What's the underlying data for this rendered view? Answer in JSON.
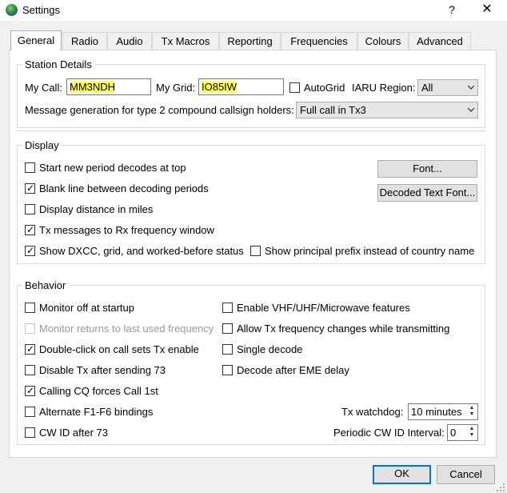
{
  "window": {
    "title": "Settings",
    "help": "?",
    "close": "✕"
  },
  "tabs": [
    {
      "label": "General"
    },
    {
      "label": "Radio"
    },
    {
      "label": "Audio"
    },
    {
      "label": "Tx Macros"
    },
    {
      "label": "Reporting"
    },
    {
      "label": "Frequencies"
    },
    {
      "label": "Colours"
    },
    {
      "label": "Advanced"
    }
  ],
  "station": {
    "title": "Station Details",
    "my_call_label": "My Call:",
    "my_call_value": "MM3NDH",
    "my_grid_label": "My Grid:",
    "my_grid_value": "IO85IW",
    "autogrid_label": "AutoGrid",
    "autogrid_checked": false,
    "iaru_label": "IARU Region:",
    "iaru_value": "All",
    "msggen_label": "Message generation for type 2 compound callsign holders:",
    "msggen_value": "Full call in Tx3"
  },
  "display": {
    "title": "Display",
    "items": [
      {
        "label": "Start new period decodes at top",
        "checked": false
      },
      {
        "label": "Blank line between decoding periods",
        "checked": true
      },
      {
        "label": "Display distance in miles",
        "checked": false
      },
      {
        "label": "Tx messages to Rx frequency window",
        "checked": true
      },
      {
        "label": "Show DXCC, grid, and worked-before status",
        "checked": true
      },
      {
        "label": "Show principal prefix instead of country name",
        "checked": false
      }
    ],
    "font_button": "Font...",
    "decoded_font_button": "Decoded Text Font..."
  },
  "behavior": {
    "title": "Behavior",
    "left": [
      {
        "label": "Monitor off at startup",
        "checked": false,
        "disabled": false
      },
      {
        "label": "Monitor returns to last used frequency",
        "checked": false,
        "disabled": true
      },
      {
        "label": "Double-click on call sets Tx enable",
        "checked": true,
        "disabled": false
      },
      {
        "label": "Disable Tx after sending 73",
        "checked": false,
        "disabled": false
      },
      {
        "label": "Calling CQ forces Call 1st",
        "checked": true,
        "disabled": false
      },
      {
        "label": "Alternate F1-F6 bindings",
        "checked": false,
        "disabled": false
      },
      {
        "label": "CW ID after 73",
        "checked": false,
        "disabled": false
      }
    ],
    "right": [
      {
        "label": "Enable VHF/UHF/Microwave features",
        "checked": false
      },
      {
        "label": "Allow Tx frequency changes while transmitting",
        "checked": false
      },
      {
        "label": "Single decode",
        "checked": false
      },
      {
        "label": "Decode after EME delay",
        "checked": false
      }
    ],
    "watchdog_label": "Tx watchdog:",
    "watchdog_value": "10 minutes",
    "cwid_label": "Periodic CW ID Interval:",
    "cwid_value": "0"
  },
  "footer": {
    "ok": "OK",
    "cancel": "Cancel"
  },
  "colors": {
    "highlight": "#ffff45",
    "accent": "#0078d7"
  }
}
